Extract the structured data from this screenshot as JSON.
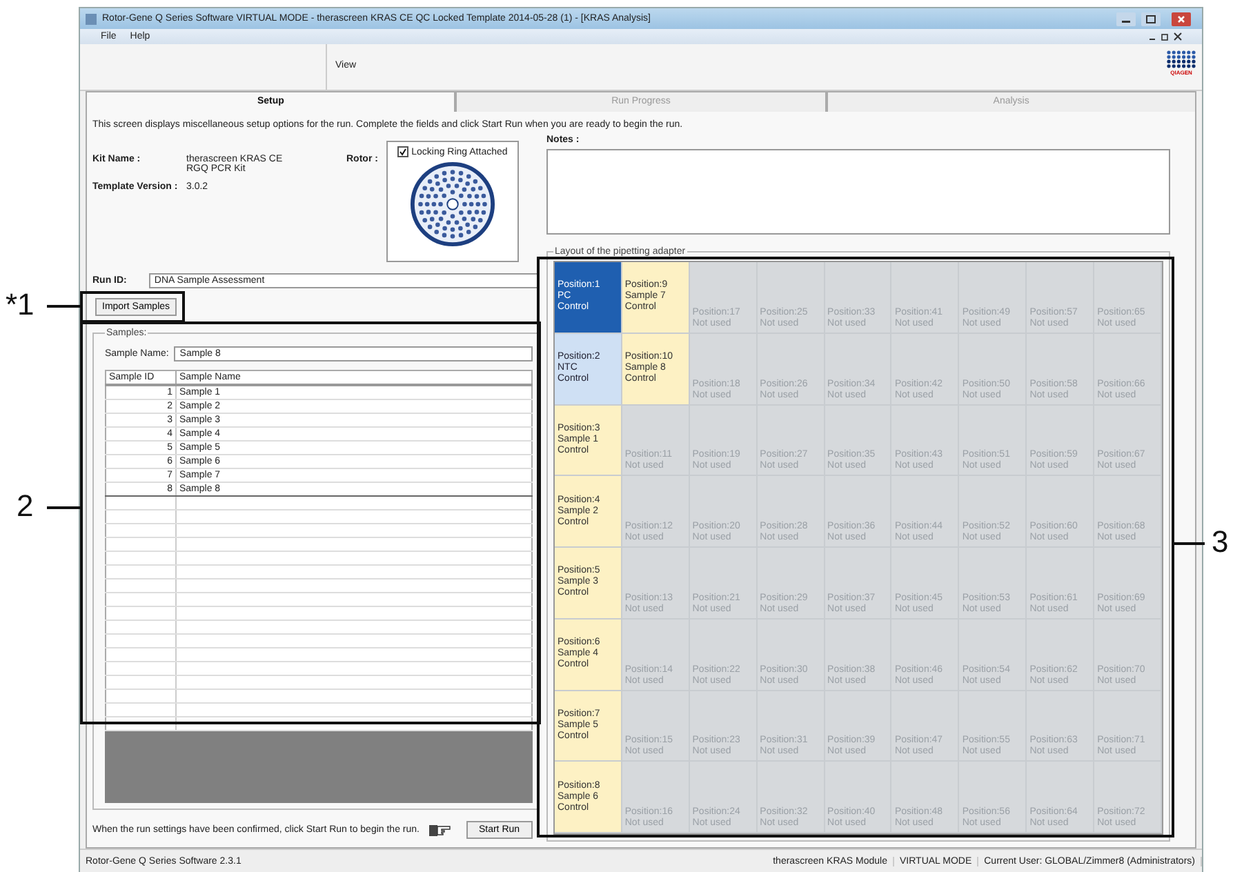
{
  "window": {
    "title": "Rotor-Gene Q Series Software VIRTUAL MODE - therascreen KRAS CE QC Locked Template 2014-05-28 (1) - [KRAS Analysis]"
  },
  "menu": [
    "File",
    "Help"
  ],
  "toolbar": {
    "label": "View",
    "logo_text": "QIAGEN"
  },
  "tabs": [
    {
      "label": "Setup",
      "selected": true
    },
    {
      "label": "Run Progress",
      "selected": false
    },
    {
      "label": "Analysis",
      "selected": false
    }
  ],
  "intro": "This screen displays miscellaneous setup options for the run. Complete the fields and click Start Run when you are ready to begin the run.",
  "kit": {
    "kit_name_label": "Kit Name :",
    "kit_name": "therascreen KRAS CE RGQ PCR Kit",
    "template_label": "Template Version :",
    "template": "3.0.2",
    "rotor_label": "Rotor :",
    "locking_ring": {
      "label": "Locking Ring Attached",
      "checked": true
    }
  },
  "run_id": {
    "label": "Run ID:",
    "value": "DNA Sample Assessment"
  },
  "import_button": "Import Samples",
  "samples": {
    "legend": "Samples:",
    "name_label": "Sample Name:",
    "name_value": "Sample 8",
    "columns": [
      "Sample ID",
      "Sample Name"
    ],
    "rows": [
      {
        "id": "1",
        "name": "Sample 1",
        "selected": false
      },
      {
        "id": "2",
        "name": "Sample 2",
        "selected": false
      },
      {
        "id": "3",
        "name": "Sample 3",
        "selected": false
      },
      {
        "id": "4",
        "name": "Sample 4",
        "selected": false
      },
      {
        "id": "5",
        "name": "Sample 5",
        "selected": false
      },
      {
        "id": "6",
        "name": "Sample 6",
        "selected": false
      },
      {
        "id": "7",
        "name": "Sample 7",
        "selected": false
      },
      {
        "id": "8",
        "name": "Sample 8",
        "selected": true
      }
    ]
  },
  "footer": {
    "text": "When the run settings have been confirmed, click Start Run to begin the run.",
    "button": "Start Run"
  },
  "notes": {
    "label": "Notes :"
  },
  "layout": {
    "legend": "Layout of the pipetting adapter",
    "rows": [
      [
        {
          "kind": "pc",
          "lines": [
            "Position:1",
            "PC",
            "Control"
          ]
        },
        {
          "kind": "sample",
          "lines": [
            "Position:9",
            "Sample 7",
            "Control"
          ]
        },
        {
          "kind": "unused",
          "lines": [
            "Position:17",
            "Not used"
          ]
        },
        {
          "kind": "unused",
          "lines": [
            "Position:25",
            "Not used"
          ]
        },
        {
          "kind": "unused",
          "lines": [
            "Position:33",
            "Not used"
          ]
        },
        {
          "kind": "unused",
          "lines": [
            "Position:41",
            "Not used"
          ]
        },
        {
          "kind": "unused",
          "lines": [
            "Position:49",
            "Not used"
          ]
        },
        {
          "kind": "unused",
          "lines": [
            "Position:57",
            "Not used"
          ]
        },
        {
          "kind": "unused",
          "lines": [
            "Position:65",
            "Not used"
          ]
        }
      ],
      [
        {
          "kind": "ntc",
          "lines": [
            "Position:2",
            "NTC",
            "Control"
          ]
        },
        {
          "kind": "sample",
          "lines": [
            "Position:10",
            "Sample 8",
            "Control"
          ]
        },
        {
          "kind": "unused",
          "lines": [
            "Position:18",
            "Not used"
          ]
        },
        {
          "kind": "unused",
          "lines": [
            "Position:26",
            "Not used"
          ]
        },
        {
          "kind": "unused",
          "lines": [
            "Position:34",
            "Not used"
          ]
        },
        {
          "kind": "unused",
          "lines": [
            "Position:42",
            "Not used"
          ]
        },
        {
          "kind": "unused",
          "lines": [
            "Position:50",
            "Not used"
          ]
        },
        {
          "kind": "unused",
          "lines": [
            "Position:58",
            "Not used"
          ]
        },
        {
          "kind": "unused",
          "lines": [
            "Position:66",
            "Not used"
          ]
        }
      ],
      [
        {
          "kind": "sample",
          "lines": [
            "Position:3",
            "Sample 1",
            "Control"
          ]
        },
        {
          "kind": "unused",
          "lines": [
            "Position:11",
            "Not used"
          ]
        },
        {
          "kind": "unused",
          "lines": [
            "Position:19",
            "Not used"
          ]
        },
        {
          "kind": "unused",
          "lines": [
            "Position:27",
            "Not used"
          ]
        },
        {
          "kind": "unused",
          "lines": [
            "Position:35",
            "Not used"
          ]
        },
        {
          "kind": "unused",
          "lines": [
            "Position:43",
            "Not used"
          ]
        },
        {
          "kind": "unused",
          "lines": [
            "Position:51",
            "Not used"
          ]
        },
        {
          "kind": "unused",
          "lines": [
            "Position:59",
            "Not used"
          ]
        },
        {
          "kind": "unused",
          "lines": [
            "Position:67",
            "Not used"
          ]
        }
      ],
      [
        {
          "kind": "sample",
          "lines": [
            "Position:4",
            "Sample 2",
            "Control"
          ]
        },
        {
          "kind": "unused",
          "lines": [
            "Position:12",
            "Not used"
          ]
        },
        {
          "kind": "unused",
          "lines": [
            "Position:20",
            "Not used"
          ]
        },
        {
          "kind": "unused",
          "lines": [
            "Position:28",
            "Not used"
          ]
        },
        {
          "kind": "unused",
          "lines": [
            "Position:36",
            "Not used"
          ]
        },
        {
          "kind": "unused",
          "lines": [
            "Position:44",
            "Not used"
          ]
        },
        {
          "kind": "unused",
          "lines": [
            "Position:52",
            "Not used"
          ]
        },
        {
          "kind": "unused",
          "lines": [
            "Position:60",
            "Not used"
          ]
        },
        {
          "kind": "unused",
          "lines": [
            "Position:68",
            "Not used"
          ]
        }
      ],
      [
        {
          "kind": "sample",
          "lines": [
            "Position:5",
            "Sample 3",
            "Control"
          ]
        },
        {
          "kind": "unused",
          "lines": [
            "Position:13",
            "Not used"
          ]
        },
        {
          "kind": "unused",
          "lines": [
            "Position:21",
            "Not used"
          ]
        },
        {
          "kind": "unused",
          "lines": [
            "Position:29",
            "Not used"
          ]
        },
        {
          "kind": "unused",
          "lines": [
            "Position:37",
            "Not used"
          ]
        },
        {
          "kind": "unused",
          "lines": [
            "Position:45",
            "Not used"
          ]
        },
        {
          "kind": "unused",
          "lines": [
            "Position:53",
            "Not used"
          ]
        },
        {
          "kind": "unused",
          "lines": [
            "Position:61",
            "Not used"
          ]
        },
        {
          "kind": "unused",
          "lines": [
            "Position:69",
            "Not used"
          ]
        }
      ],
      [
        {
          "kind": "sample",
          "lines": [
            "Position:6",
            "Sample 4",
            "Control"
          ]
        },
        {
          "kind": "unused",
          "lines": [
            "Position:14",
            "Not used"
          ]
        },
        {
          "kind": "unused",
          "lines": [
            "Position:22",
            "Not used"
          ]
        },
        {
          "kind": "unused",
          "lines": [
            "Position:30",
            "Not used"
          ]
        },
        {
          "kind": "unused",
          "lines": [
            "Position:38",
            "Not used"
          ]
        },
        {
          "kind": "unused",
          "lines": [
            "Position:46",
            "Not used"
          ]
        },
        {
          "kind": "unused",
          "lines": [
            "Position:54",
            "Not used"
          ]
        },
        {
          "kind": "unused",
          "lines": [
            "Position:62",
            "Not used"
          ]
        },
        {
          "kind": "unused",
          "lines": [
            "Position:70",
            "Not used"
          ]
        }
      ],
      [
        {
          "kind": "sample",
          "lines": [
            "Position:7",
            "Sample 5",
            "Control"
          ]
        },
        {
          "kind": "unused",
          "lines": [
            "Position:15",
            "Not used"
          ]
        },
        {
          "kind": "unused",
          "lines": [
            "Position:23",
            "Not used"
          ]
        },
        {
          "kind": "unused",
          "lines": [
            "Position:31",
            "Not used"
          ]
        },
        {
          "kind": "unused",
          "lines": [
            "Position:39",
            "Not used"
          ]
        },
        {
          "kind": "unused",
          "lines": [
            "Position:47",
            "Not used"
          ]
        },
        {
          "kind": "unused",
          "lines": [
            "Position:55",
            "Not used"
          ]
        },
        {
          "kind": "unused",
          "lines": [
            "Position:63",
            "Not used"
          ]
        },
        {
          "kind": "unused",
          "lines": [
            "Position:71",
            "Not used"
          ]
        }
      ],
      [
        {
          "kind": "sample",
          "lines": [
            "Position:8",
            "Sample 6",
            "Control"
          ]
        },
        {
          "kind": "unused",
          "lines": [
            "Position:16",
            "Not used"
          ]
        },
        {
          "kind": "unused",
          "lines": [
            "Position:24",
            "Not used"
          ]
        },
        {
          "kind": "unused",
          "lines": [
            "Position:32",
            "Not used"
          ]
        },
        {
          "kind": "unused",
          "lines": [
            "Position:40",
            "Not used"
          ]
        },
        {
          "kind": "unused",
          "lines": [
            "Position:48",
            "Not used"
          ]
        },
        {
          "kind": "unused",
          "lines": [
            "Position:56",
            "Not used"
          ]
        },
        {
          "kind": "unused",
          "lines": [
            "Position:64",
            "Not used"
          ]
        },
        {
          "kind": "unused",
          "lines": [
            "Position:72",
            "Not used"
          ]
        }
      ]
    ]
  },
  "status_bar": [
    "Rotor-Gene Q Series Software 2.3.1",
    "therascreen KRAS Module",
    "VIRTUAL MODE",
    "Current User: GLOBAL/Zimmer8 (Administrators)"
  ],
  "callouts": [
    "*1",
    "2",
    "3"
  ]
}
